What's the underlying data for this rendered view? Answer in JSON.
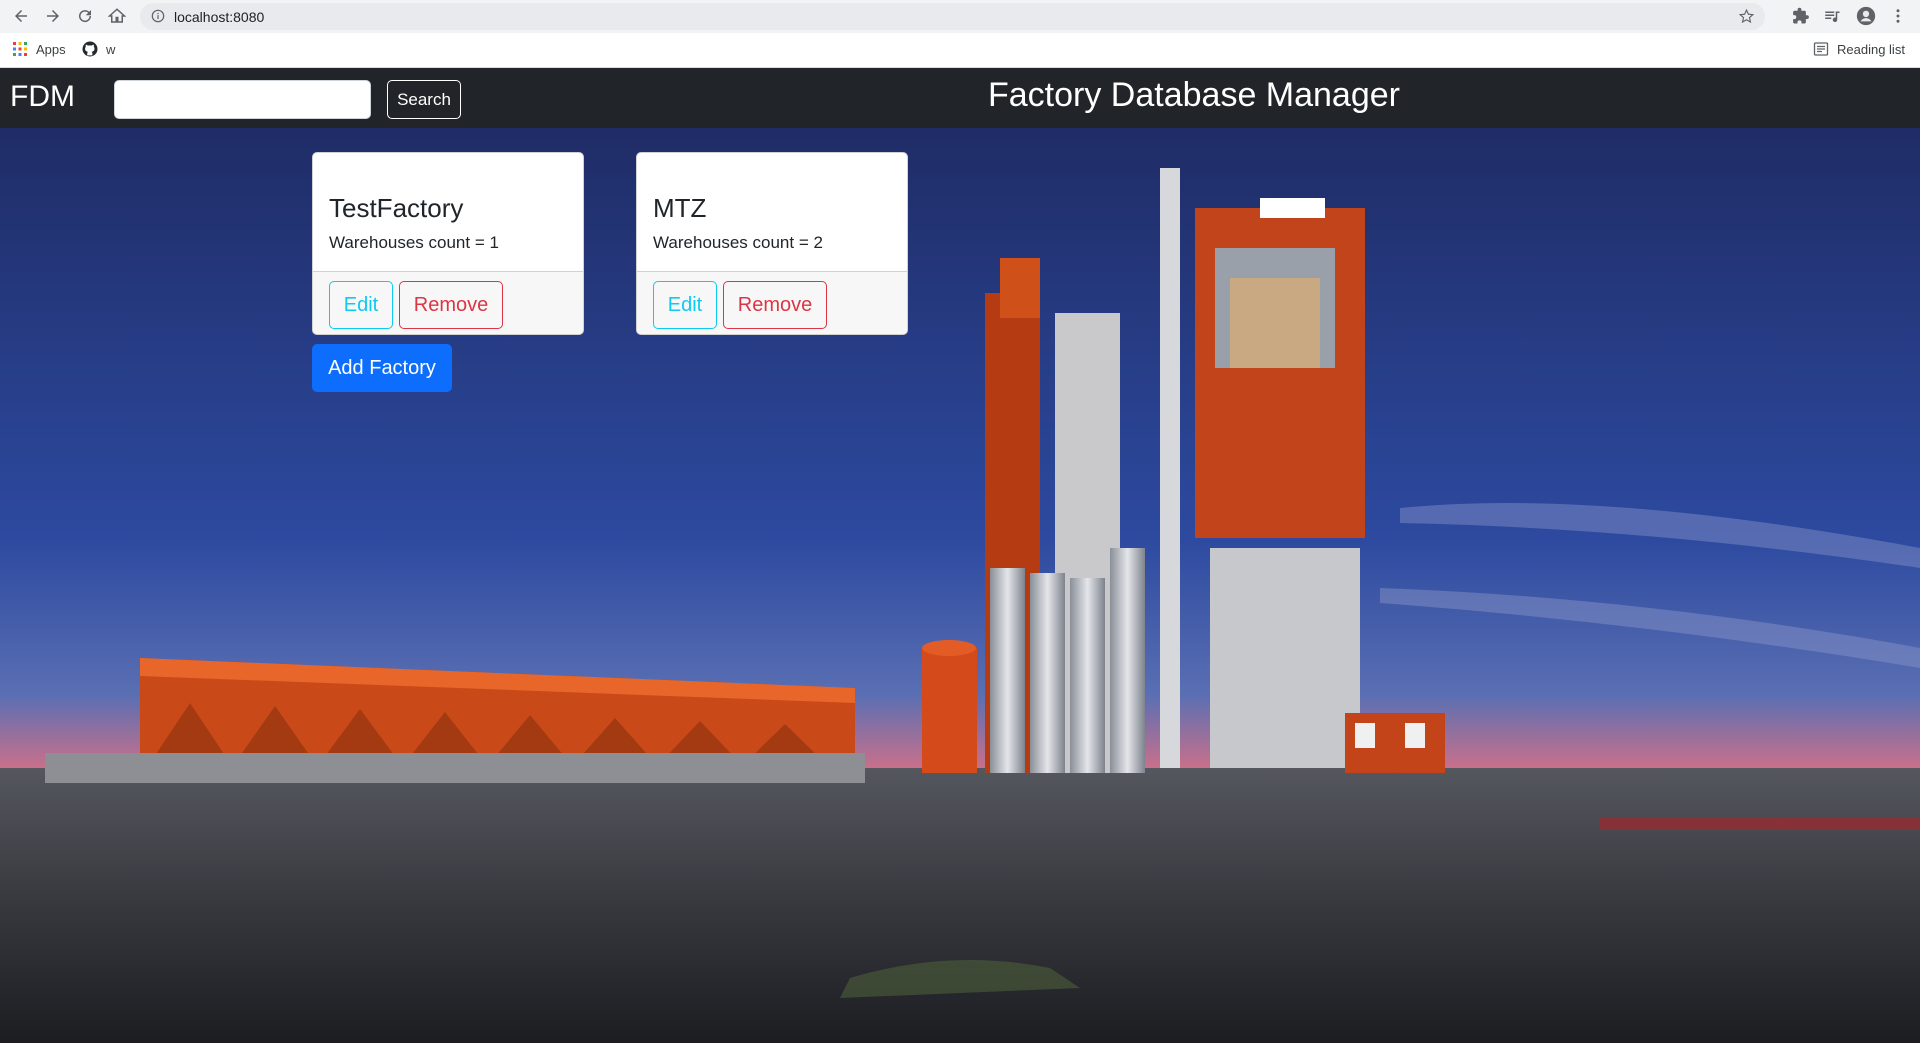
{
  "browser": {
    "url": "localhost:8080",
    "bookmarks": [
      {
        "label": "Apps",
        "icon": "apps-grid-icon"
      },
      {
        "label": "w",
        "icon": "github-icon"
      }
    ],
    "reading_list": "Reading list"
  },
  "navbar": {
    "brand": "FDM",
    "search_placeholder": "",
    "search_button": "Search",
    "title": "Factory Database Manager"
  },
  "factories": [
    {
      "name": "TestFactory",
      "warehouses": "Warehouses count = 1",
      "edit": "Edit",
      "remove": "Remove"
    },
    {
      "name": "MTZ",
      "warehouses": "Warehouses count = 2",
      "edit": "Edit",
      "remove": "Remove"
    }
  ],
  "add_button": "Add Factory",
  "colors": {
    "navbar": "#212529",
    "primary": "#0d6efd",
    "info": "#0dcaf0",
    "danger": "#dc3545"
  }
}
